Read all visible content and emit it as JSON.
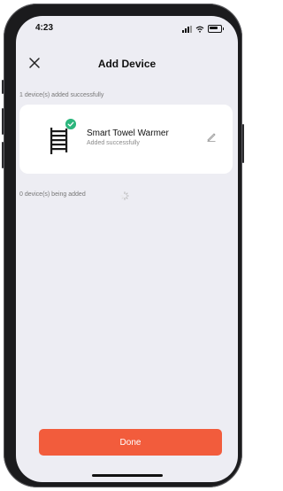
{
  "status_bar": {
    "time": "4:23"
  },
  "header": {
    "title": "Add Device",
    "close_icon": "close-icon"
  },
  "added_section": {
    "label": "1 device(s) added successfully",
    "devices": [
      {
        "name": "Smart Towel Warmer",
        "status": "Added successfully",
        "icon": "towel-warmer-icon",
        "badge_icon": "check-icon",
        "edit_icon": "pencil-icon"
      }
    ]
  },
  "adding_section": {
    "label": "0 device(s) being added",
    "icon": "loading-spinner-icon"
  },
  "footer": {
    "done_label": "Done"
  },
  "colors": {
    "accent": "#f25c3c",
    "success": "#2cb67d",
    "background": "#ededf3",
    "card": "#ffffff"
  }
}
